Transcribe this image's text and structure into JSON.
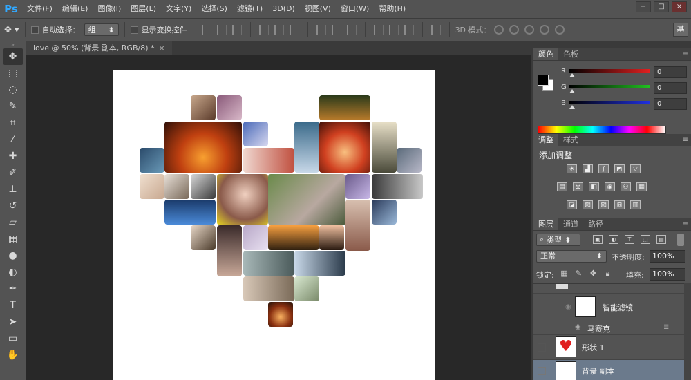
{
  "menubar": {
    "logo": "Ps",
    "items": [
      "文件(F)",
      "编辑(E)",
      "图像(I)",
      "图层(L)",
      "文字(Y)",
      "选择(S)",
      "滤镜(T)",
      "3D(D)",
      "视图(V)",
      "窗口(W)",
      "帮助(H)"
    ],
    "window_controls": [
      "−",
      "□",
      "×"
    ]
  },
  "options": {
    "auto_select_label": "自动选择：",
    "auto_select_value": "组",
    "show_transform_label": "显示变换控件",
    "mode_3d_label": "3D 模式：",
    "workspace_button": "基"
  },
  "document": {
    "tab_title": "love @ 50% (背景 副本, RGB/8) *",
    "tab_close": "×"
  },
  "color_panel": {
    "tabs": [
      "颜色",
      "色板"
    ],
    "channels": [
      {
        "label": "R",
        "value": "0",
        "color": "#d02020"
      },
      {
        "label": "G",
        "value": "0",
        "color": "#20b020"
      },
      {
        "label": "B",
        "value": "0",
        "color": "#2030d0"
      }
    ],
    "foreground": "#000000",
    "background": "#ffffff"
  },
  "adjustments_panel": {
    "tabs": [
      "调整",
      "样式"
    ],
    "title": "添加调整",
    "icons_row1": [
      "brightness-icon",
      "levels-icon",
      "curves-icon",
      "exposure-icon",
      "vibrance-icon"
    ],
    "icons_row2": [
      "hue-saturation-icon",
      "color-balance-icon",
      "black-white-icon",
      "photo-filter-icon",
      "channel-mixer-icon",
      "color-lookup-icon"
    ],
    "icons_row3": [
      "invert-icon",
      "posterize-icon",
      "threshold-icon",
      "selective-color-icon",
      "gradient-map-icon"
    ]
  },
  "layers_panel": {
    "tabs": [
      "图层",
      "通道",
      "路径"
    ],
    "filter_kind": "类型",
    "blend_mode": "正常",
    "opacity_label": "不透明度:",
    "opacity_value": "100%",
    "lock_label": "锁定:",
    "fill_label": "填充:",
    "fill_value": "100%",
    "layers": [
      {
        "name": "智能滤镜"
      },
      {
        "name": "马赛克"
      },
      {
        "name": "形状 1"
      },
      {
        "name": "背景 副本"
      }
    ]
  }
}
